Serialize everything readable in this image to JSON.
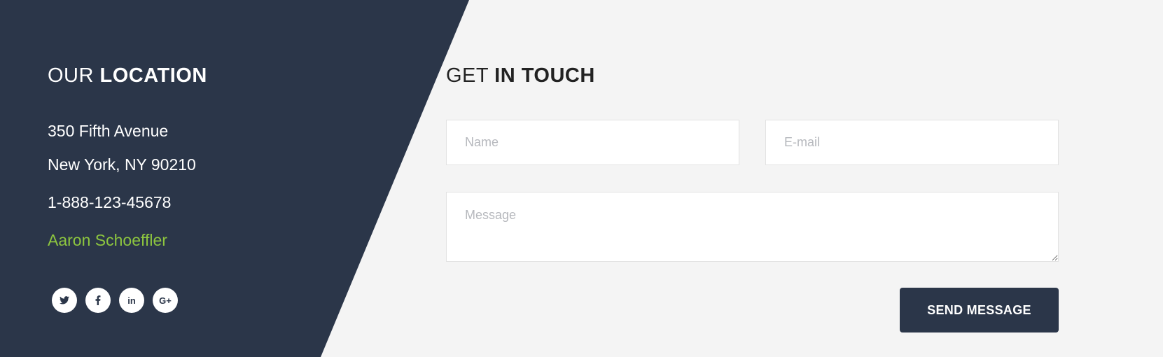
{
  "location": {
    "heading_thin": "OUR",
    "heading_bold": "LOCATION",
    "address_line1": "350 Fifth Avenue",
    "address_line2": "New York, NY 90210",
    "phone": "1-888-123-45678",
    "contact_name": "Aaron Schoeffler",
    "socials": [
      {
        "icon": "twitter-icon"
      },
      {
        "icon": "facebook-icon"
      },
      {
        "icon": "linkedin-icon",
        "glyph": "in"
      },
      {
        "icon": "google-plus-icon",
        "glyph": "G+"
      }
    ]
  },
  "contact": {
    "heading_thin": "GET",
    "heading_bold": "IN TOUCH",
    "name_placeholder": "Name",
    "email_placeholder": "E-mail",
    "message_placeholder": "Message",
    "send_label": "SEND MESSAGE"
  },
  "colors": {
    "dark_panel": "#2b3649",
    "accent_green": "#8dc63f",
    "background": "#f4f4f4"
  }
}
